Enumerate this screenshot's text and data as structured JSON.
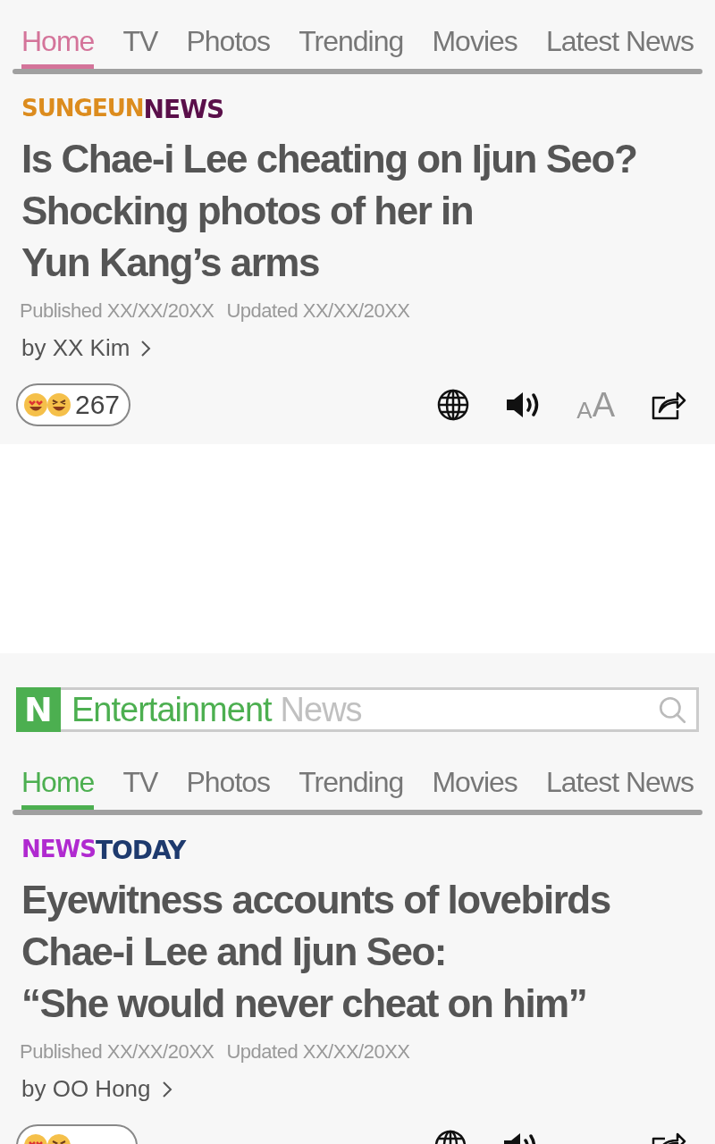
{
  "articles": [
    {
      "color": "#d4749a",
      "tabs": [
        {
          "label": "Home",
          "selected": true
        },
        {
          "label": "TV",
          "selected": false
        },
        {
          "label": "Photos",
          "selected": false
        },
        {
          "label": "Trending",
          "selected": false
        },
        {
          "label": "Movies",
          "selected": false
        },
        {
          "label": "Latest News",
          "selected": false
        }
      ],
      "source": [
        {
          "text": "SUNGEUN",
          "color": "#dc8c1e"
        },
        {
          "text": "NEWS",
          "color": "#5a0f4a"
        }
      ],
      "headline_lines": [
        "Is Chae-i Lee cheating on Ijun Seo?",
        "Shocking photos of her in",
        "Yun Kang’s arms"
      ],
      "published": "Published XX/XX/20XX",
      "updated": "Updated XX/XX/20XX",
      "byline": "by XX Kim",
      "reactions": "267",
      "text_size": {
        "small": "A",
        "large": "A"
      }
    },
    {
      "color": "#4caf50",
      "search": {
        "brand_letter": "N",
        "title": "Entertainment",
        "title_suffix": "News"
      },
      "tabs": [
        {
          "label": "Home",
          "selected": true
        },
        {
          "label": "TV",
          "selected": false
        },
        {
          "label": "Photos",
          "selected": false
        },
        {
          "label": "Trending",
          "selected": false
        },
        {
          "label": "Movies",
          "selected": false
        },
        {
          "label": "Latest News",
          "selected": false
        }
      ],
      "source": [
        {
          "text": "NEWS",
          "color": "#b02ad0"
        },
        {
          "text": "TODAY",
          "color": "#1e3a6e"
        }
      ],
      "headline_lines": [
        "Eyewitness accounts of lovebirds",
        "Chae-i Lee and Ijun Seo:",
        "“She would never cheat on him”"
      ],
      "published": "Published XX/XX/20XX",
      "updated": "Updated XX/XX/20XX",
      "byline": "by OO Hong"
    }
  ]
}
